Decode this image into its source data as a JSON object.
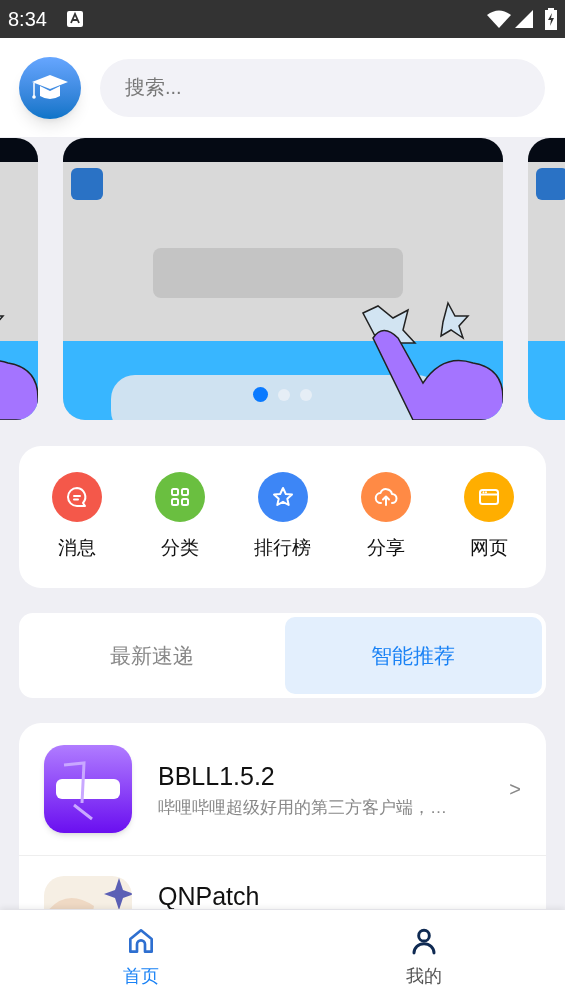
{
  "status_bar": {
    "time": "8:34"
  },
  "search": {
    "placeholder": "搜索..."
  },
  "banner": {
    "dots": [
      {
        "selected": true
      },
      {
        "selected": false
      },
      {
        "selected": false
      }
    ]
  },
  "menu": [
    {
      "label": "消息",
      "color": "#f4584a"
    },
    {
      "label": "分类",
      "color": "#6abf40"
    },
    {
      "label": "排行榜",
      "color": "#3d86f6"
    },
    {
      "label": "分享",
      "color": "#ff8a45"
    },
    {
      "label": "网页",
      "color": "#ffae00"
    }
  ],
  "tabs": [
    {
      "label": "最新速递",
      "selected": false
    },
    {
      "label": "智能推荐",
      "selected": true
    }
  ],
  "apps": [
    {
      "name": "BBLL1.5.2",
      "description": "哔哩哔哩超级好用的第三方客户端，…",
      "chevron": ">"
    },
    {
      "name": "QNPatch"
    }
  ],
  "nav": [
    {
      "label": "首页",
      "selected": true
    },
    {
      "label": "我的",
      "selected": false
    }
  ]
}
